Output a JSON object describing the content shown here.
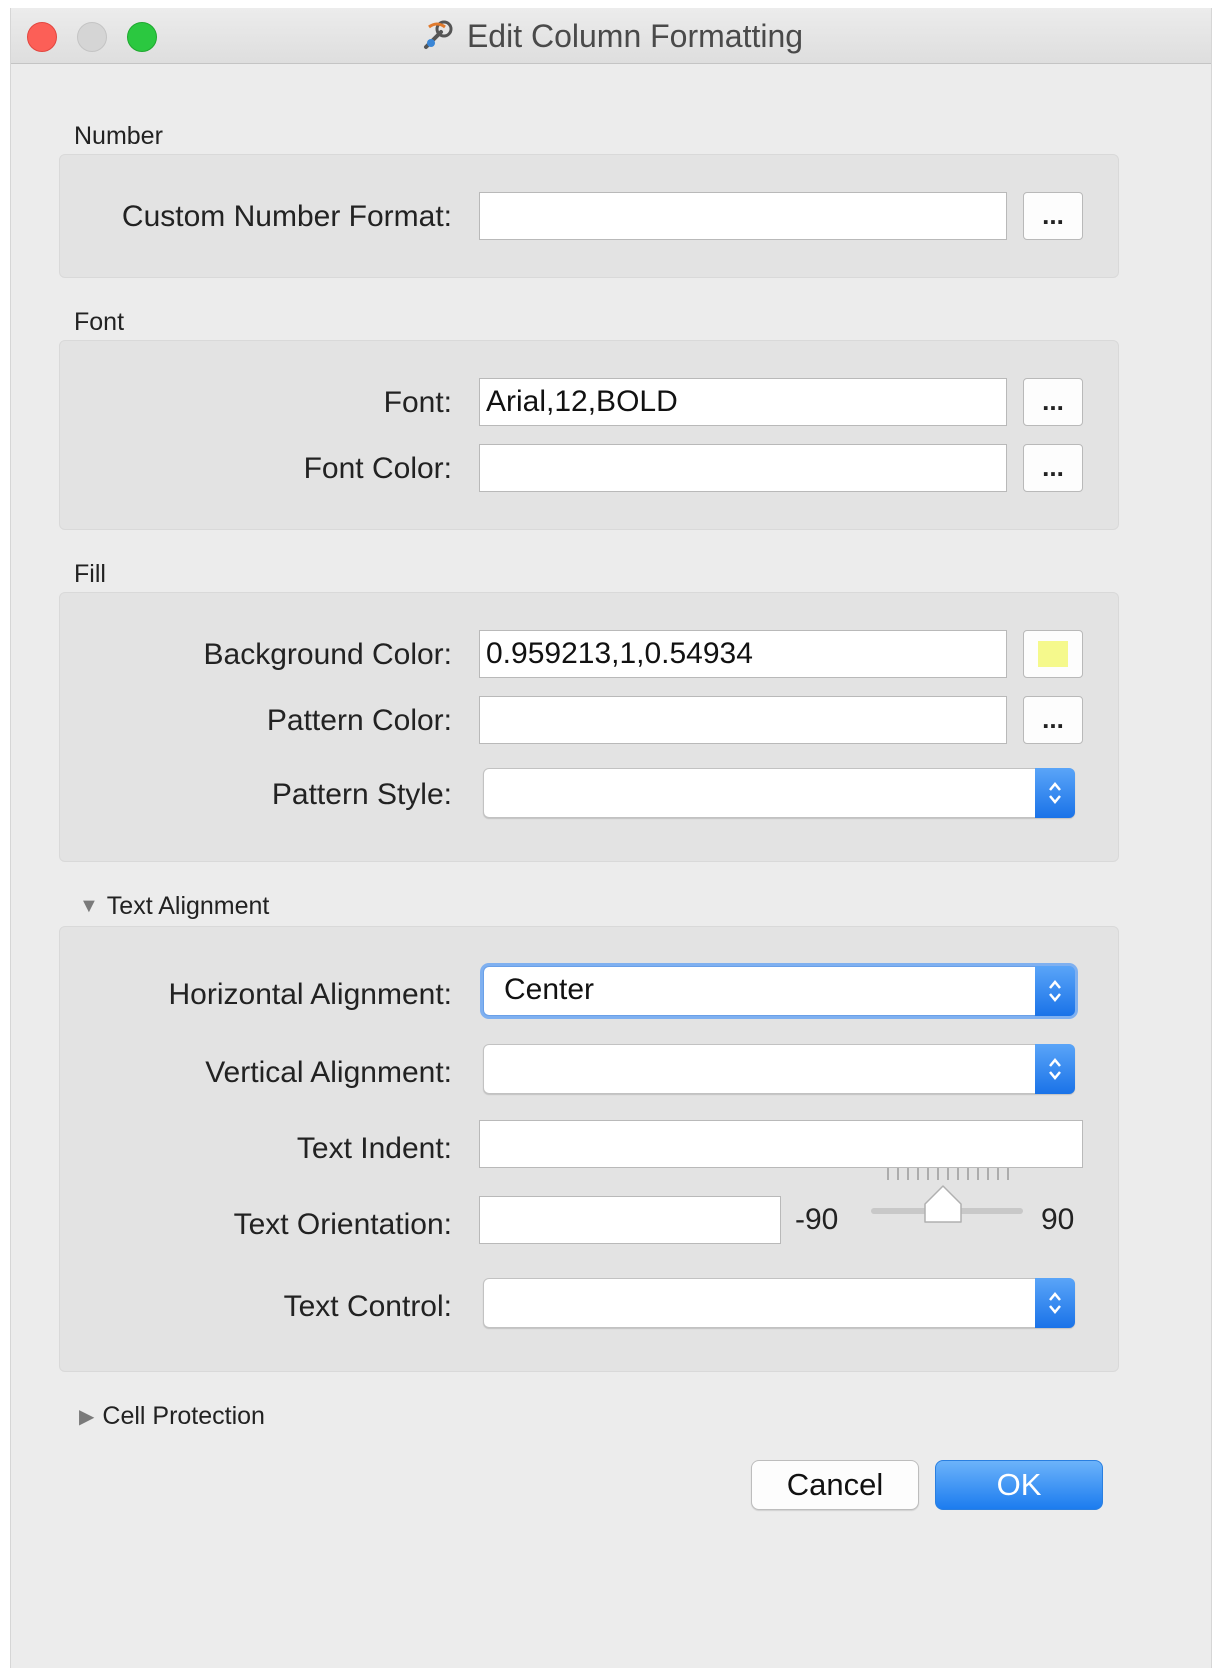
{
  "window": {
    "title": "Edit Column Formatting",
    "title_icon": "transformer-wrench-icon"
  },
  "sections": {
    "number": {
      "label": "Number",
      "custom_number_format_label": "Custom Number Format:",
      "custom_number_format_value": "",
      "dots_label": "..."
    },
    "font": {
      "label": "Font",
      "font_label": "Font:",
      "font_value": "Arial,12,BOLD",
      "font_color_label": "Font Color:",
      "font_color_value": "",
      "dots_label": "..."
    },
    "fill": {
      "label": "Fill",
      "background_color_label": "Background Color:",
      "background_color_value": "0.959213,1,0.54934",
      "background_swatch_color": "#f5f98c",
      "pattern_color_label": "Pattern Color:",
      "pattern_color_value": "",
      "pattern_style_label": "Pattern Style:",
      "pattern_style_value": "",
      "dots_label": "..."
    },
    "text_alignment": {
      "label": "Text Alignment",
      "expanded": true,
      "horizontal_label": "Horizontal Alignment:",
      "horizontal_value": "Center",
      "vertical_label": "Vertical Alignment:",
      "vertical_value": "",
      "indent_label": "Text Indent:",
      "indent_value": "",
      "orientation_label": "Text Orientation:",
      "orientation_value": "",
      "orientation_min": "-90",
      "orientation_max": "90",
      "orientation_slider_value": 0,
      "control_label": "Text Control:",
      "control_value": ""
    },
    "cell_protection": {
      "label": "Cell Protection",
      "expanded": false
    }
  },
  "buttons": {
    "cancel": "Cancel",
    "ok": "OK"
  },
  "colors": {
    "accent": "#1c7cef",
    "close": "#fc5f57",
    "zoom": "#2bc840"
  }
}
